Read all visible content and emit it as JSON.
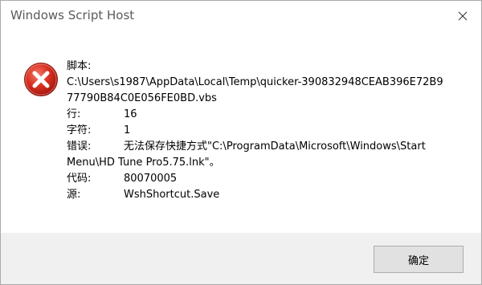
{
  "window": {
    "title": "Windows Script Host",
    "close_icon": "close-icon"
  },
  "error": {
    "icon": "error-icon",
    "script_label": "脚本:",
    "script_path_line1": "C:\\Users\\s1987\\AppData\\Local\\Temp\\quicker-390832948CEAB396E72B9",
    "script_path_line2": "77790B84C0E056FE0BD.vbs",
    "line_label": "行:",
    "line_value": "16",
    "char_label": "字符:",
    "char_value": "1",
    "error_label": "错误:",
    "error_line1": "无法保存快捷方式\"C:\\ProgramData\\Microsoft\\Windows\\Start",
    "error_line2": "Menu\\HD Tune Pro5.75.lnk\"。",
    "code_label": "代码:",
    "code_value": "80070005",
    "source_label": "源:",
    "source_value": "WshShortcut.Save"
  },
  "footer": {
    "ok_label": "确定"
  },
  "colors": {
    "icon_red": "#d9301f",
    "footer_bg": "#f0f0f0",
    "button_bg": "#e1e1e1"
  }
}
